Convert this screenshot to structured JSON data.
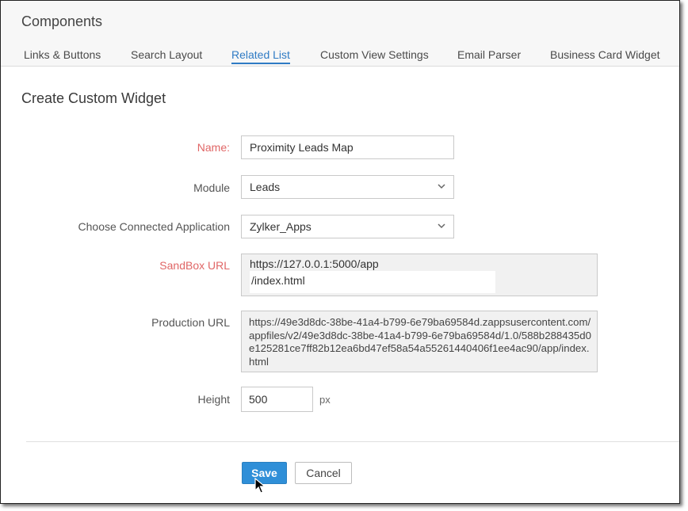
{
  "header": {
    "title": "Components",
    "tabs": [
      {
        "label": "Links & Buttons"
      },
      {
        "label": "Search Layout"
      },
      {
        "label": "Related List"
      },
      {
        "label": "Custom View Settings"
      },
      {
        "label": "Email Parser"
      },
      {
        "label": "Business Card Widget"
      }
    ],
    "active_tab": "Related List"
  },
  "form": {
    "title": "Create Custom Widget",
    "name": {
      "label": "Name:",
      "value": "Proximity Leads Map"
    },
    "module": {
      "label": "Module",
      "value": "Leads"
    },
    "connected_app": {
      "label": "Choose Connected Application",
      "value": "Zylker_Apps"
    },
    "sandbox_url": {
      "label": "SandBox URL",
      "line1": "https://127.0.0.1:5000/app",
      "line2": "/index.html"
    },
    "production_url": {
      "label": "Production URL",
      "value": "https://49e3d8dc-38be-41a4-b799-6e79ba69584d.zappsusercontent.com/appfiles/v2/49e3d8dc-38be-41a4-b799-6e79ba69584d/1.0/588b288435d0e125281ce7ff82b12ea6bd47ef58a54a55261440406f1ee4ac90/app/index.html"
    },
    "height": {
      "label": "Height",
      "value": "500",
      "unit": "px"
    }
  },
  "actions": {
    "save_label": "Save",
    "cancel_label": "Cancel"
  },
  "colors": {
    "accent": "#2f7bc4",
    "save_button": "#2f8fd8",
    "required_label": "#e06666"
  },
  "icons": [
    "chevron-down-icon",
    "mouse-pointer-icon"
  ]
}
